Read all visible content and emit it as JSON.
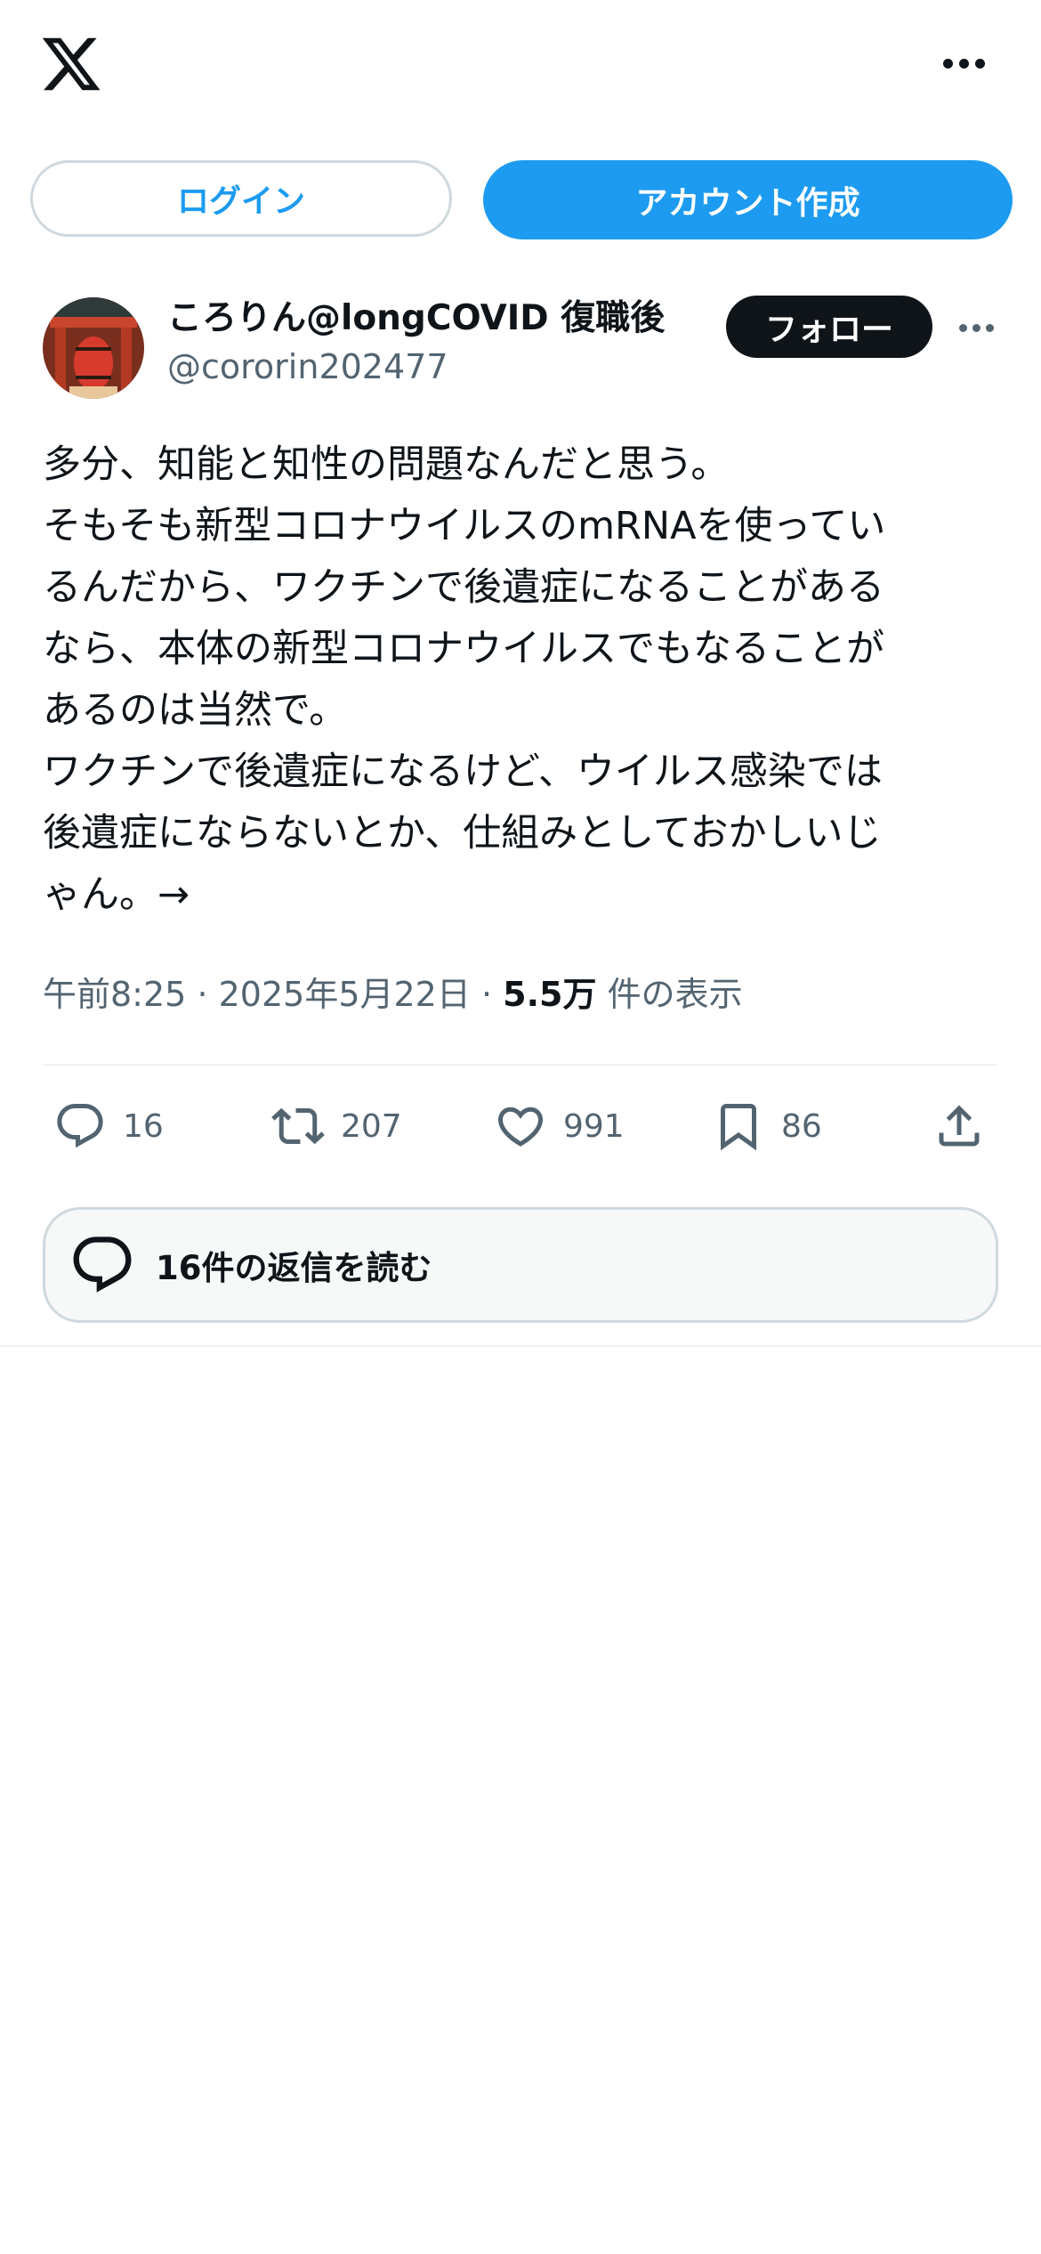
{
  "header": {
    "logo": "x-logo-icon",
    "menu": "more-icon"
  },
  "auth": {
    "login": "ログイン",
    "signup": "アカウント作成"
  },
  "author": {
    "display_name": "ころりん@longCOVID 復職後",
    "handle": "@cororin202477",
    "follow": "フォロー"
  },
  "tweet": {
    "lines": [
      "多分、知能と知性の問題なんだと思う。",
      "そもそも新型コロナウイルスのmRNAを使ってい",
      "るんだから、ワクチンで後遺症になることがある",
      "なら、本体の新型コロナウイルスでもなることが",
      "あるのは当然で。",
      "ワクチンで後遺症になるけど、ウイルス感染では",
      "後遺症にならないとか、仕組みとしておかしいじ",
      "ゃん。→"
    ],
    "time": "午前8:25",
    "date": "2025年5月22日",
    "sep": "·",
    "views": "5.5万",
    "views_label": "件の表示"
  },
  "actions": {
    "replies": "16",
    "retweets": "207",
    "likes": "991",
    "bookmarks": "86"
  },
  "read_replies": "16件の返信を読む",
  "colors": {
    "accent": "#1d9bf0",
    "text": "#0f1419",
    "muted": "#536471"
  }
}
